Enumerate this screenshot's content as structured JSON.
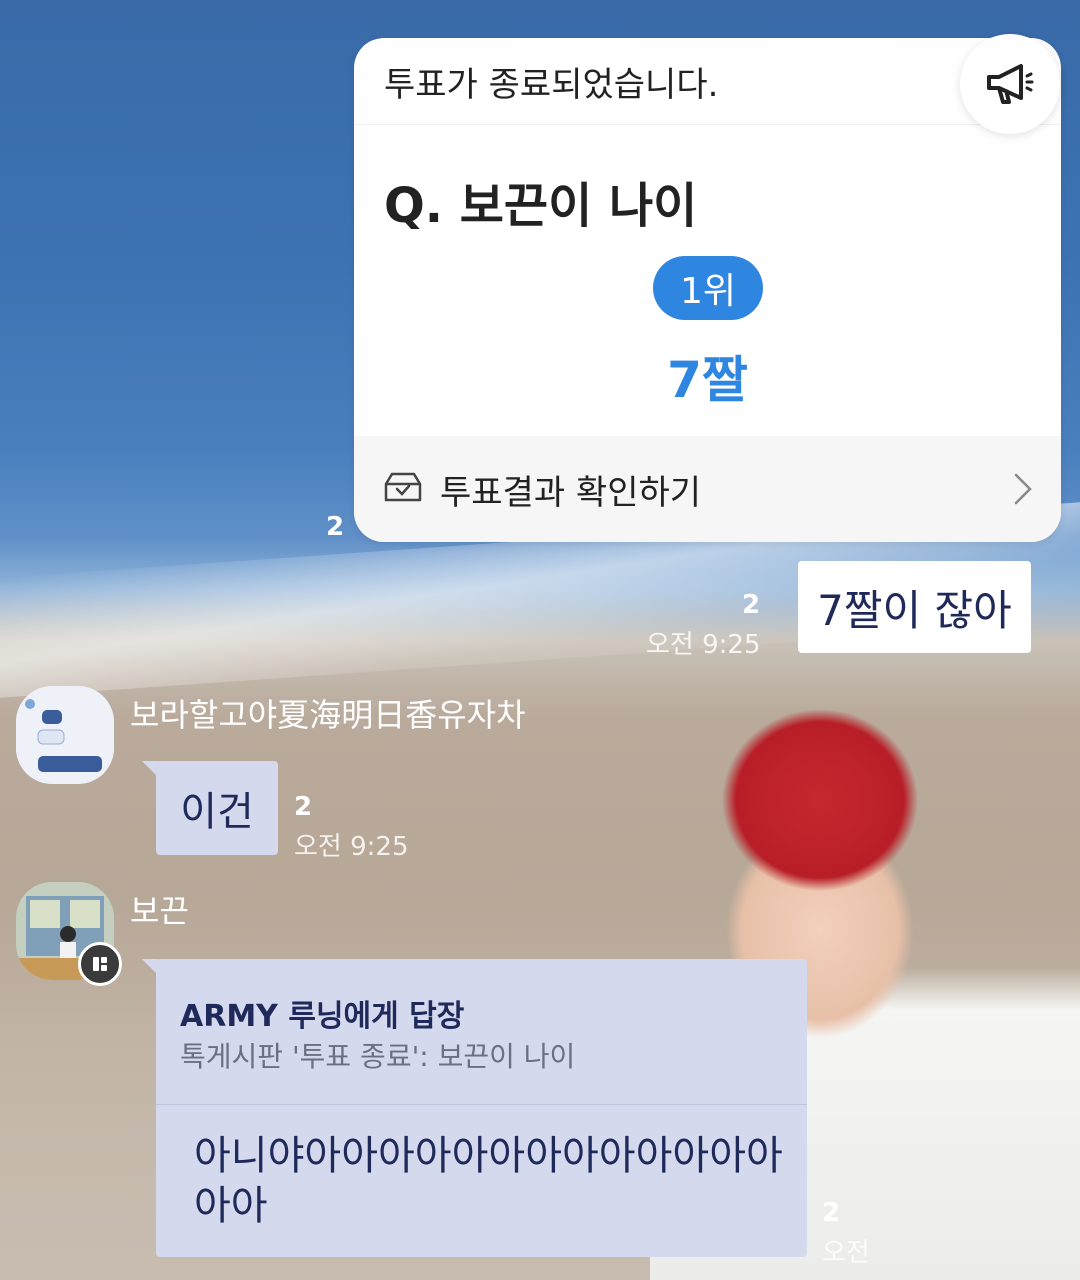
{
  "notice": {
    "status": "투표가 종료되었습니다.",
    "question": "Q. 보끈이 나이",
    "rank": "1위",
    "answer": "7짤",
    "footer_label": "투표결과 확인하기",
    "icon": "megaphone-icon"
  },
  "notice_unread": "2",
  "my_message": {
    "text": "7짤이 잖아",
    "unread": "2",
    "time": "오전 9:25"
  },
  "messages": [
    {
      "sender": "보라할고야夏海明日香유자차",
      "text": "이건",
      "unread": "2",
      "time": "오전 9:25"
    },
    {
      "sender": "보끈",
      "reply_to": "ARMY 루닝에게 답장",
      "reply_source": "톡게시판 '투표 종료': 보끈이 나이",
      "text": "아니야아아아아아아아아아아아아아아아",
      "unread": "2",
      "time": "오전"
    }
  ],
  "colors": {
    "accent": "#2f86e0",
    "bubble_other": "#d4d9ee",
    "bubble_text": "#1f2a5a"
  }
}
